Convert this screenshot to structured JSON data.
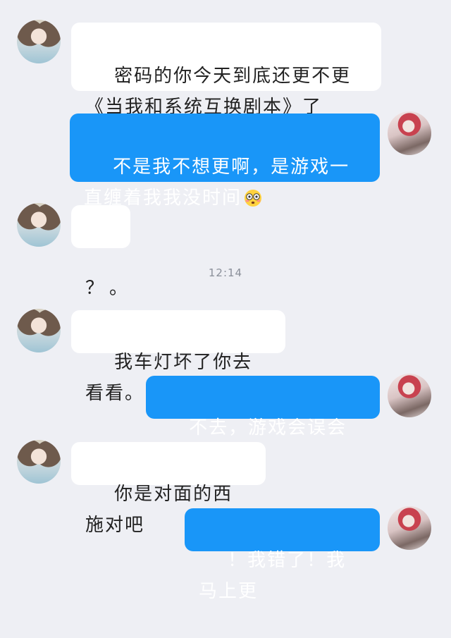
{
  "timestamp": "12:14",
  "messages": [
    {
      "side": "in",
      "text": "密码的你今天到底还更不更《当我和系统互换剧本》了"
    },
    {
      "side": "out",
      "text": "不是我不想更啊，是游戏一直缠着我我没时间",
      "emoji": "flushed-face-icon"
    },
    {
      "side": "in",
      "text": "？。"
    },
    {
      "side": "in",
      "text": "我车灯坏了你去看看。"
    },
    {
      "side": "out",
      "text": "不去，游戏会误会我们的"
    },
    {
      "side": "in",
      "text": "你是对面的西施对吧"
    },
    {
      "side": "out",
      "text": "！我错了！我马上更"
    }
  ],
  "colors": {
    "out_bubble": "#1996f8",
    "in_bubble": "#ffffff",
    "background": "#eeeff4"
  }
}
